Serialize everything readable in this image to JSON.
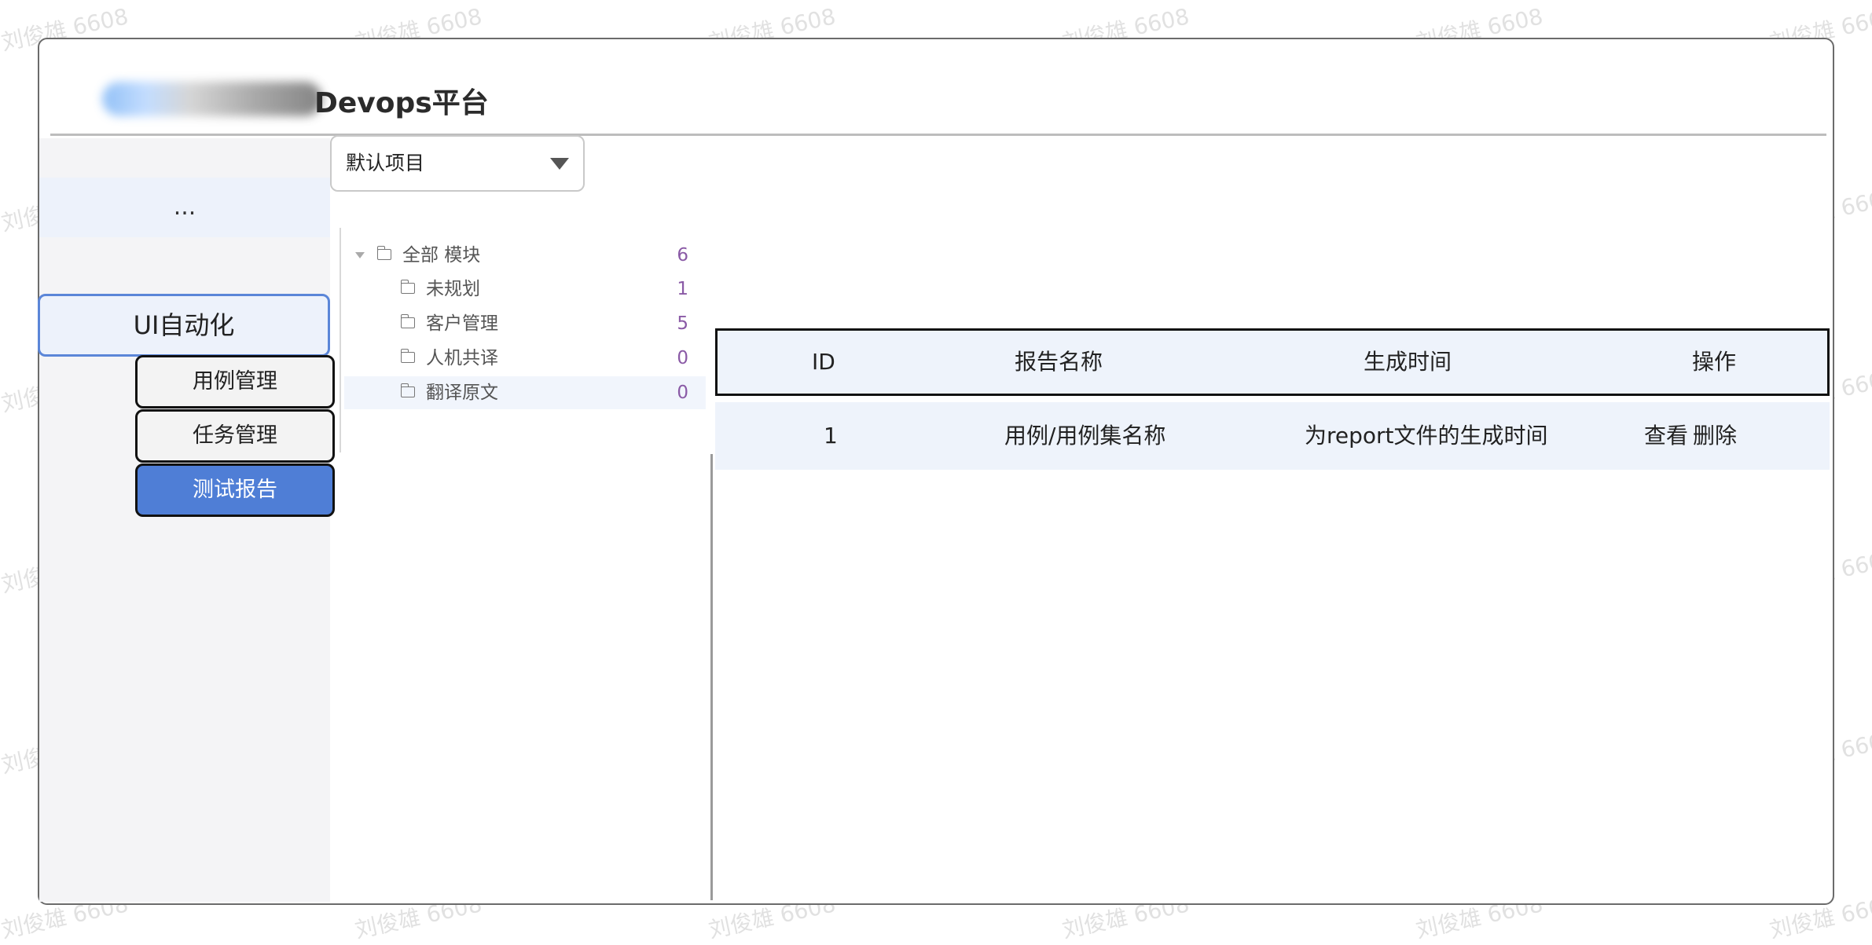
{
  "header": {
    "title": "Devops平台"
  },
  "sidebar": {
    "top_label": "...",
    "main_item": "UI自动化",
    "sub_items": [
      {
        "label": "用例管理",
        "active": false
      },
      {
        "label": "任务管理",
        "active": false
      },
      {
        "label": "测试报告",
        "active": true
      }
    ]
  },
  "project_select": {
    "value": "默认项目"
  },
  "tree": {
    "root": {
      "label": "全部 模块",
      "count": "6"
    },
    "children": [
      {
        "label": "未规划",
        "count": "1"
      },
      {
        "label": "客户管理",
        "count": "5"
      },
      {
        "label": "人机共译",
        "count": "0"
      },
      {
        "label": "翻译原文",
        "count": "0"
      }
    ]
  },
  "table": {
    "columns": [
      "ID",
      "报告名称",
      "生成时间",
      "操作"
    ],
    "rows": [
      {
        "id": "1",
        "name": "用例/用例集名称",
        "time": "为report文件的生成时间",
        "view": "查看",
        "delete": "删除"
      }
    ]
  },
  "watermark": "刘俊雄 6608",
  "colors": {
    "accent": "#4f7ed6",
    "selected_bg": "#eef3fb",
    "count": "#8a5aa6"
  }
}
